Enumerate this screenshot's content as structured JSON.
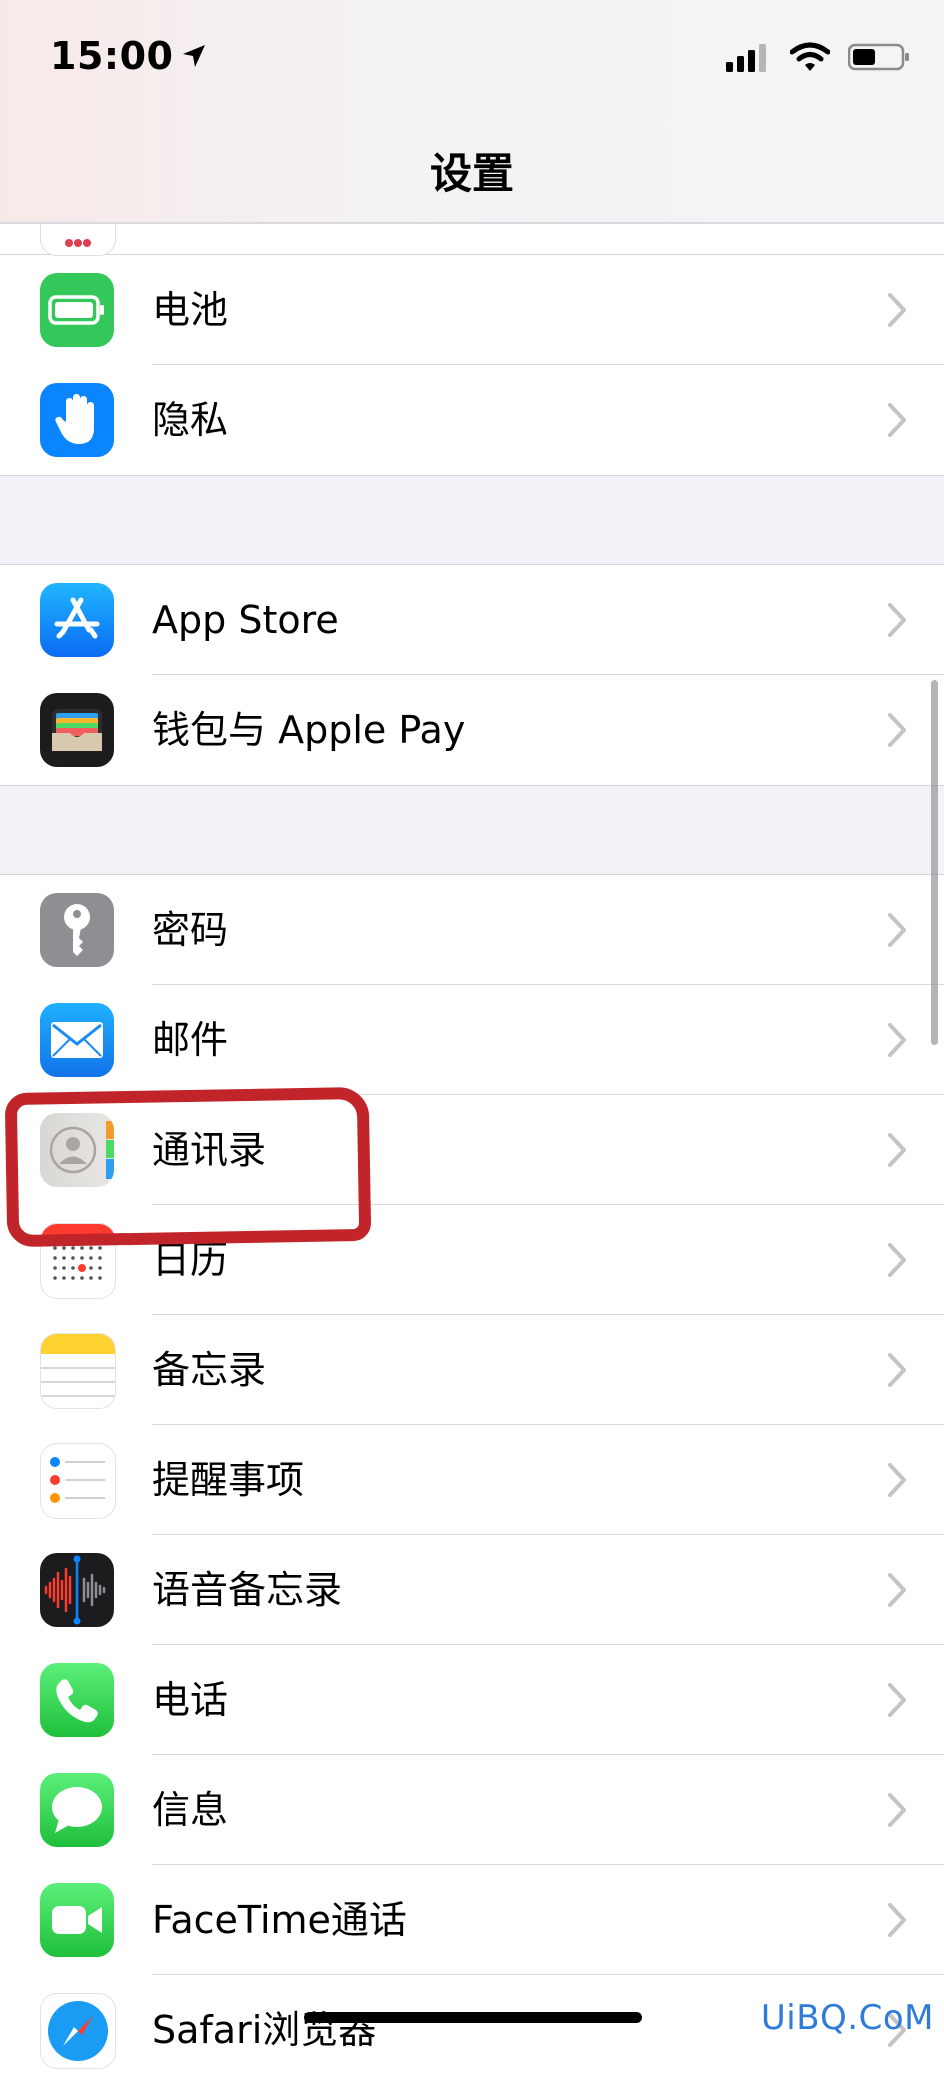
{
  "status_bar": {
    "time": "15:00"
  },
  "nav": {
    "title": "设置"
  },
  "groups": [
    {
      "items": [
        {
          "label": "电池",
          "icon": "battery-icon"
        },
        {
          "label": "隐私",
          "icon": "hand-privacy-icon"
        }
      ]
    },
    {
      "items": [
        {
          "label": "App Store",
          "icon": "app-store-icon"
        },
        {
          "label": "钱包与 Apple Pay",
          "icon": "wallet-icon"
        }
      ]
    },
    {
      "items": [
        {
          "label": "密码",
          "icon": "key-icon"
        },
        {
          "label": "邮件",
          "icon": "mail-icon"
        },
        {
          "label": "通讯录",
          "icon": "contacts-icon"
        },
        {
          "label": "日历",
          "icon": "calendar-icon"
        },
        {
          "label": "备忘录",
          "icon": "notes-icon"
        },
        {
          "label": "提醒事项",
          "icon": "reminders-icon"
        },
        {
          "label": "语音备忘录",
          "icon": "voice-memos-icon"
        },
        {
          "label": "电话",
          "icon": "phone-icon"
        },
        {
          "label": "信息",
          "icon": "messages-icon"
        },
        {
          "label": "FaceTime通话",
          "icon": "facetime-icon"
        },
        {
          "label": "Safari浏览器",
          "icon": "safari-icon"
        }
      ]
    }
  ],
  "watermark": "UiBQ.CoM",
  "colors": {
    "highlight": "#c1252a",
    "green": "#34c759",
    "blue": "#0a84ff"
  }
}
